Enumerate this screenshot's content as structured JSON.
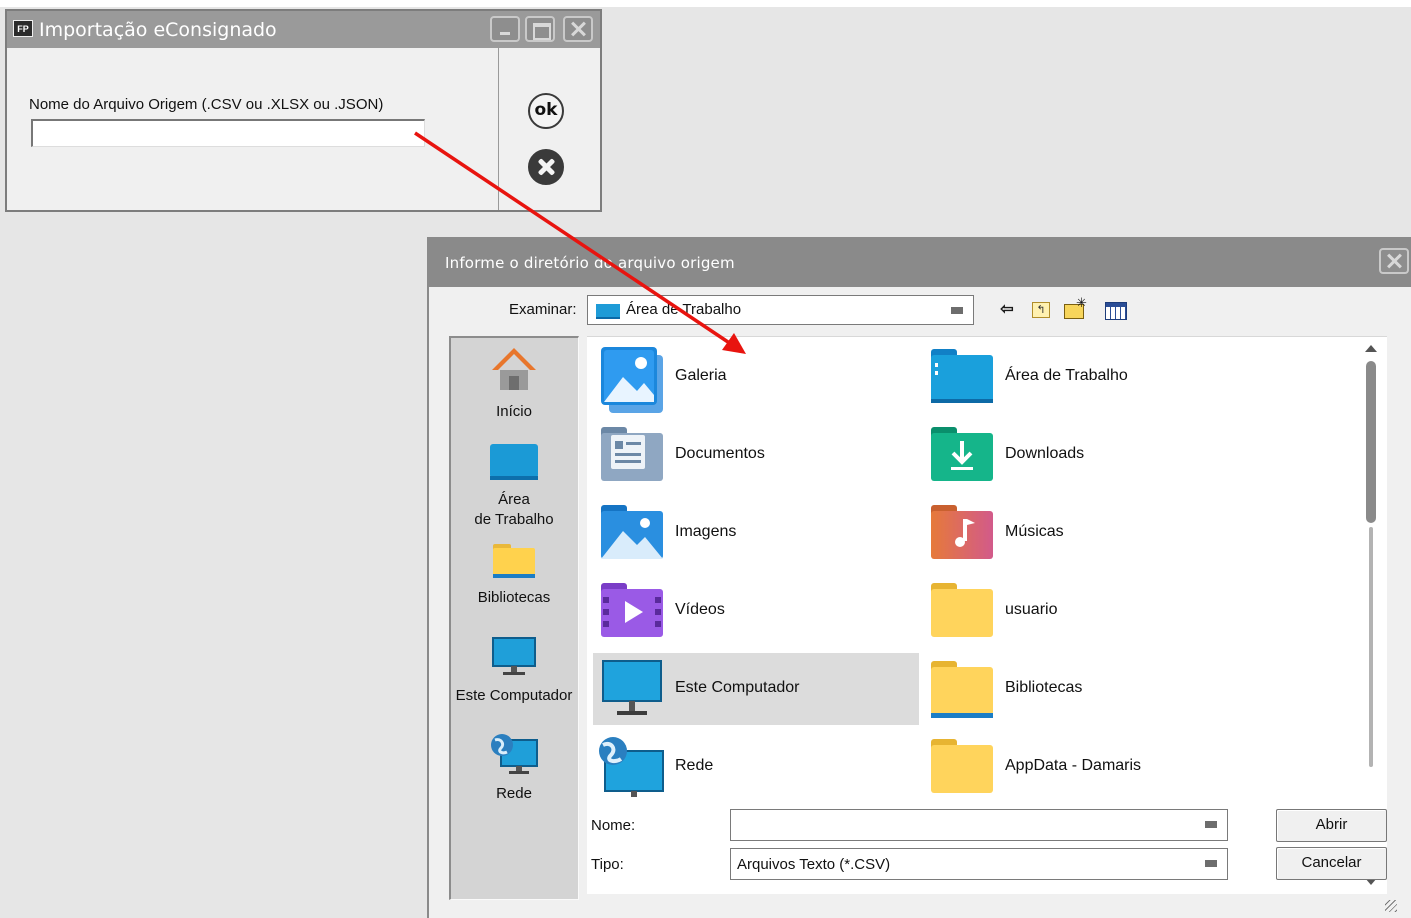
{
  "import_window": {
    "app_icon": "FP",
    "title": "Importação eConsignado",
    "source_label": "Nome do Arquivo Origem (.CSV ou .XLSX ou .JSON)",
    "source_value": "",
    "browse_label": "...",
    "ok_label": "ok",
    "buttons": [
      "minimize-icon",
      "maximize-icon",
      "close-icon"
    ]
  },
  "file_dialog": {
    "title": "Informe o diretório do arquivo origem",
    "look_in_label": "Examinar:",
    "look_in_value": "Área de Trabalho",
    "toolbar_icons": [
      "back-arrow-icon",
      "up-folder-icon",
      "new-folder-icon",
      "details-view-icon"
    ],
    "places": [
      {
        "label": "Início",
        "icon": "home-icon"
      },
      {
        "label": "Área\nde Trabalho",
        "icon": "desktop-icon"
      },
      {
        "label": "Bibliotecas",
        "icon": "libraries-folder-icon"
      },
      {
        "label": "Este Computador",
        "icon": "computer-icon"
      },
      {
        "label": "Rede",
        "icon": "network-icon"
      }
    ],
    "items": [
      {
        "label": "Galeria",
        "icon": "gallery-icon"
      },
      {
        "label": "Área de Trabalho",
        "icon": "desktop-folder-icon"
      },
      {
        "label": "Documentos",
        "icon": "documents-folder-icon"
      },
      {
        "label": "Downloads",
        "icon": "downloads-folder-icon"
      },
      {
        "label": "Imagens",
        "icon": "pictures-folder-icon"
      },
      {
        "label": "Músicas",
        "icon": "music-folder-icon"
      },
      {
        "label": "Vídeos",
        "icon": "videos-folder-icon"
      },
      {
        "label": "usuario",
        "icon": "user-folder-icon"
      },
      {
        "label": "Este Computador",
        "icon": "computer-icon",
        "selected": true
      },
      {
        "label": "Bibliotecas",
        "icon": "libraries-folder-icon"
      },
      {
        "label": "Rede",
        "icon": "network-icon"
      },
      {
        "label": "AppData - Damaris",
        "icon": "folder-icon"
      }
    ],
    "name_label": "Nome:",
    "name_value": "",
    "type_label": "Tipo:",
    "type_value": "Arquivos Texto (*.CSV)",
    "open_button": "Abrir",
    "cancel_button": "Cancelar"
  },
  "colors": {
    "arrow": "#e8140f",
    "title_bar": "#9a9a9a",
    "selection": "#dcdcdc"
  }
}
